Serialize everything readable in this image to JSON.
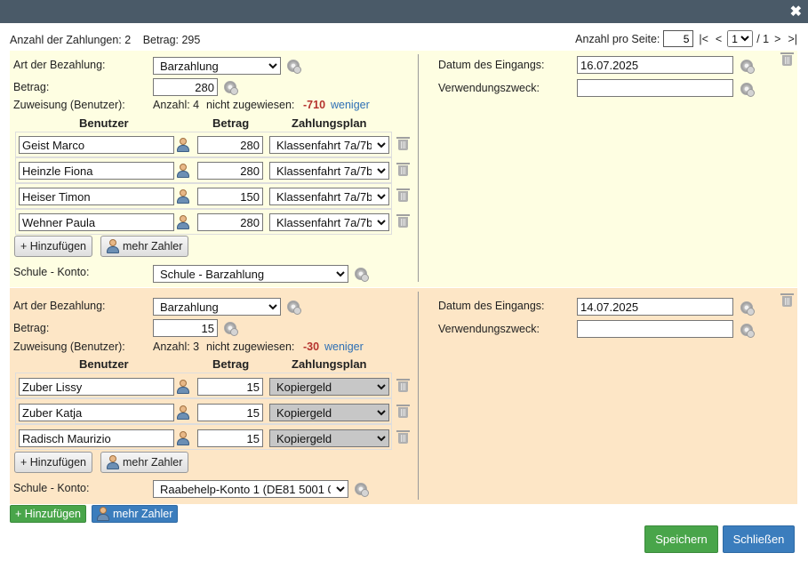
{
  "header": {
    "close_icon": "close-icon"
  },
  "summary": {
    "count_label": "Anzahl der Zahlungen: 2",
    "amount_label": "Betrag: 295"
  },
  "pager": {
    "per_page_label": "Anzahl pro Seite:",
    "per_page_value": "5",
    "first": "|<",
    "prev": "<",
    "page": "1",
    "of": "/ 1",
    "next": ">",
    "last": ">|"
  },
  "labels": {
    "art": "Art der Bezahlung:",
    "betrag": "Betrag:",
    "zuweisung": "Zuweisung (Benutzer):",
    "col_benutzer": "Benutzer",
    "col_betrag": "Betrag",
    "col_plan": "Zahlungsplan",
    "add": "+ Hinzufügen",
    "mehr_zahler": "mehr Zahler",
    "schule_konto": "Schule - Konto:",
    "datum": "Datum des Eingangs:",
    "zweck": "Verwendungszweck:",
    "weniger": "weniger"
  },
  "payments": [
    {
      "art": "Barzahlung",
      "betrag": "280",
      "anzahl": "Anzahl: 4",
      "nicht_zugewiesen_label": "nicht zugewiesen:",
      "nicht_zugewiesen": "-710",
      "konto": "Schule - Barzahlung",
      "datum": "16.07.2025",
      "zweck": "",
      "rows": [
        {
          "name": "Geist Marco",
          "betrag": "280",
          "plan": "Klassenfahrt 7a/7b"
        },
        {
          "name": "Heinzle Fiona",
          "betrag": "280",
          "plan": "Klassenfahrt 7a/7b"
        },
        {
          "name": "Heiser Timon",
          "betrag": "150",
          "plan": "Klassenfahrt 7a/7b"
        },
        {
          "name": "Wehner Paula",
          "betrag": "280",
          "plan": "Klassenfahrt 7a/7b"
        }
      ]
    },
    {
      "art": "Barzahlung",
      "betrag": "15",
      "anzahl": "Anzahl: 3",
      "nicht_zugewiesen_label": "nicht zugewiesen:",
      "nicht_zugewiesen": "-30",
      "konto": "Raabehelp-Konto 1 (DE81 5001 0",
      "datum": "14.07.2025",
      "zweck": "",
      "rows": [
        {
          "name": "Zuber Lissy",
          "betrag": "15",
          "plan": "Kopiergeld"
        },
        {
          "name": "Zuber Katja",
          "betrag": "15",
          "plan": "Kopiergeld"
        },
        {
          "name": "Radisch Maurizio",
          "betrag": "15",
          "plan": "Kopiergeld"
        }
      ]
    }
  ],
  "footer": {
    "add": "+ Hinzufügen",
    "mehr_zahler": "mehr Zahler",
    "save": "Speichern",
    "close": "Schließen"
  }
}
